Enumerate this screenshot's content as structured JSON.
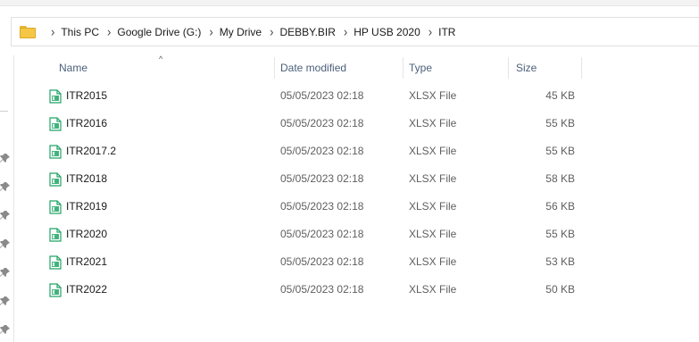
{
  "breadcrumb": {
    "icon": "folder-icon",
    "items": [
      "This PC",
      "Google Drive (G:)",
      "My Drive",
      "DEBBY.BIR",
      "HP USB 2020",
      "ITR"
    ]
  },
  "columns": {
    "name": "Name",
    "date": "Date modified",
    "type": "Type",
    "size": "Size",
    "sorted_by": "name"
  },
  "files": [
    {
      "name": "ITR2015",
      "date": "05/05/2023 02:18",
      "type": "XLSX File",
      "size": "45 KB"
    },
    {
      "name": "ITR2016",
      "date": "05/05/2023 02:18",
      "type": "XLSX File",
      "size": "55 KB"
    },
    {
      "name": "ITR2017.2",
      "date": "05/05/2023 02:18",
      "type": "XLSX File",
      "size": "55 KB"
    },
    {
      "name": "ITR2018",
      "date": "05/05/2023 02:18",
      "type": "XLSX File",
      "size": "58 KB"
    },
    {
      "name": "ITR2019",
      "date": "05/05/2023 02:18",
      "type": "XLSX File",
      "size": "56 KB"
    },
    {
      "name": "ITR2020",
      "date": "05/05/2023 02:18",
      "type": "XLSX File",
      "size": "55 KB"
    },
    {
      "name": "ITR2021",
      "date": "05/05/2023 02:18",
      "type": "XLSX File",
      "size": "53 KB"
    },
    {
      "name": "ITR2022",
      "date": "05/05/2023 02:18",
      "type": "XLSX File",
      "size": "50 KB"
    }
  ],
  "icons": {
    "file": "xlsx-file-icon",
    "quick_access": "pin-icon"
  },
  "colors": {
    "header_text": "#4c607a",
    "xlsx_green": "#21a366",
    "folder_yellow": "#f6c744"
  }
}
